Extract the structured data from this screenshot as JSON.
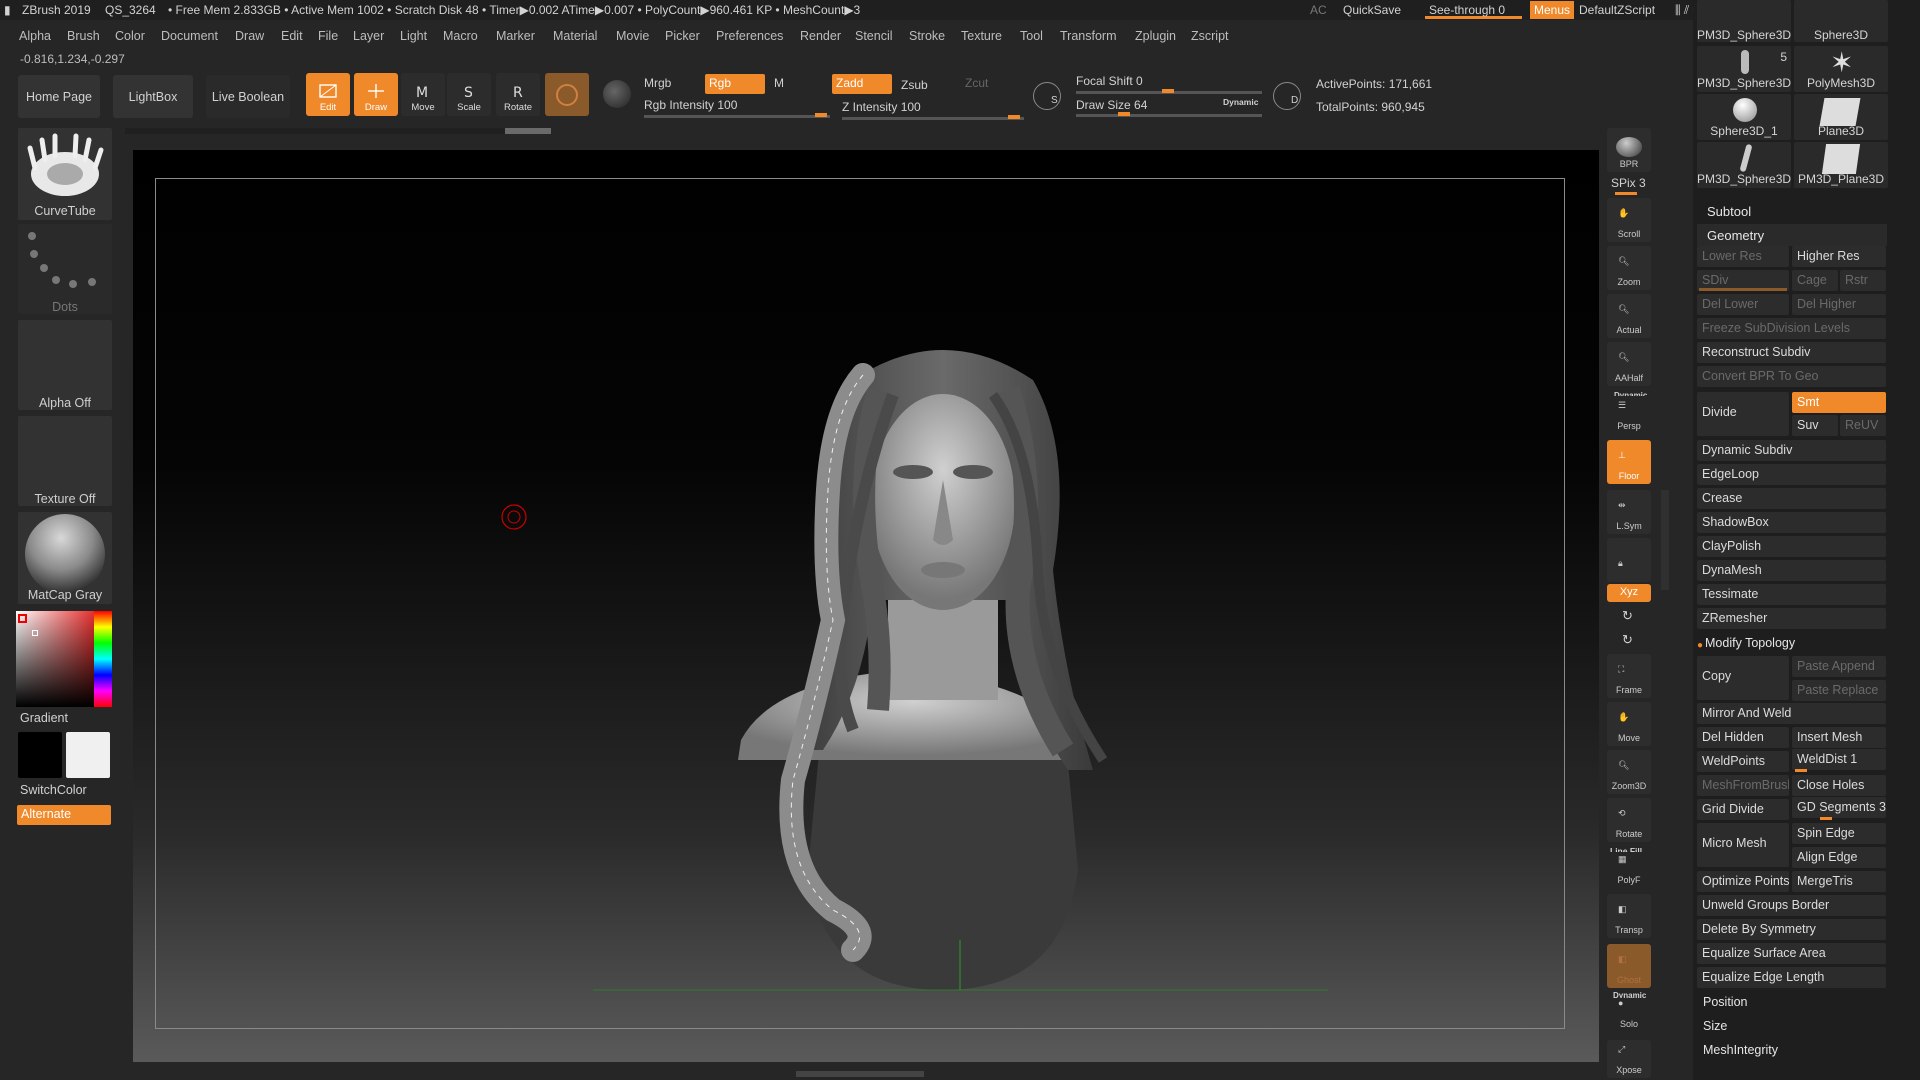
{
  "titlebar": {
    "app": "ZBrush 2019",
    "qs": "QS_3264",
    "stats": "• Free Mem 2.833GB • Active Mem 1002 • Scratch Disk 48 •  Timer▶0.002 ATime▶0.007 • PolyCount▶960.461 KP  • MeshCount▶3",
    "ac": "AC",
    "quicksave": "QuickSave",
    "seethrough": "See-through   0",
    "menus": "Menus",
    "script": "DefaultZScript"
  },
  "menubar": [
    "Alpha",
    "Brush",
    "Color",
    "Document",
    "Draw",
    "Edit",
    "File",
    "Layer",
    "Light",
    "Macro",
    "Marker",
    "Material",
    "Movie",
    "Picker",
    "Preferences",
    "Render",
    "Stencil",
    "Stroke",
    "Texture",
    "Tool",
    "Transform",
    "Zplugin",
    "Zscript"
  ],
  "coords": "-0.816,1.234,-0.297",
  "shelf": {
    "home": "Home Page",
    "lightbox": "LightBox",
    "liveboolean": "Live Boolean",
    "edit": "Edit",
    "draw": "Draw",
    "move": "Move",
    "scale": "Scale",
    "rotate": "Rotate",
    "mrgb": "Mrgb",
    "rgb": "Rgb",
    "m": "M",
    "zadd": "Zadd",
    "zsub": "Zsub",
    "zcut": "Zcut",
    "rgb_intensity": "Rgb Intensity 100",
    "z_intensity": "Z Intensity 100",
    "focal_shift": "Focal Shift 0",
    "draw_size": "Draw Size 64",
    "dynamic": "Dynamic",
    "active_points": "ActivePoints: 171,661",
    "total_points": "TotalPoints: 960,945"
  },
  "left": {
    "brush": "CurveTube",
    "stroke": "Dots",
    "alpha": "Alpha Off",
    "texture": "Texture Off",
    "material": "MatCap Gray",
    "gradient": "Gradient",
    "switchcolor": "SwitchColor",
    "alternate": "Alternate"
  },
  "right": {
    "bpr": "BPR",
    "spix": "SPix 3",
    "buttons": [
      "Scroll",
      "Zoom",
      "Actual",
      "AAHalf",
      "Persp",
      "Floor",
      "L.Sym",
      "",
      "Xyz",
      "",
      "",
      "Frame",
      "Move",
      "Zoom3D",
      "Rotate",
      "PolyF",
      "Transp",
      "Ghost",
      "Solo",
      "Xpose"
    ],
    "dynamic_label": "Dynamic",
    "linefill_label": "Line Fill",
    "dynamic2_label": "Dynamic"
  },
  "palette": {
    "thumbs": [
      "PM3D_Sphere3D",
      "Sphere3D",
      "PM3D_Sphere3D",
      "PolyMesh3D",
      "Sphere3D_1",
      "Plane3D",
      "PM3D_Sphere3D",
      "PM3D_Plane3D"
    ],
    "thumb_count": "5",
    "subtool": "Subtool",
    "geometry": "Geometry",
    "lower_res": "Lower Res",
    "higher_res": "Higher Res",
    "sdiv": "SDiv",
    "cage": "Cage",
    "rstr": "Rstr",
    "del_lower": "Del Lower",
    "del_higher": "Del Higher",
    "freeze": "Freeze SubDivision Levels",
    "reconstruct": "Reconstruct Subdiv",
    "convert_bpr": "Convert BPR To Geo",
    "divide": "Divide",
    "smt": "Smt",
    "suv": "Suv",
    "reuv": "ReUV",
    "sections": [
      "Dynamic Subdiv",
      "EdgeLoop",
      "Crease",
      "ShadowBox",
      "ClayPolish",
      "DynaMesh",
      "Tessimate",
      "ZRemesher"
    ],
    "modify_topology": "Modify Topology",
    "copy": "Copy",
    "paste_append": "Paste Append",
    "paste_replace": "Paste Replace",
    "mirror_weld": "Mirror And Weld",
    "del_hidden": "Del Hidden",
    "insert_mesh": "Insert Mesh",
    "weldpoints": "WeldPoints",
    "welddist": "WeldDist 1",
    "meshfrombrush": "MeshFromBrush",
    "close_holes": "Close Holes",
    "grid_divide": "Grid Divide",
    "gd_segments": "GD Segments 3",
    "micro_mesh": "Micro Mesh",
    "spin_edge": "Spin Edge",
    "align_edge": "Align Edge",
    "optimize_points": "Optimize Points",
    "mergetris": "MergeTris",
    "unweld_groups": "Unweld Groups Border",
    "delete_symmetry": "Delete By Symmetry",
    "equalize_area": "Equalize Surface Area",
    "equalize_edge": "Equalize Edge Length",
    "position": "Position",
    "size": "Size",
    "meshintegrity": "MeshIntegrity"
  },
  "colors": {
    "accent": "#f0892a",
    "bg": "#262626",
    "panel": "#1e1e1e"
  }
}
